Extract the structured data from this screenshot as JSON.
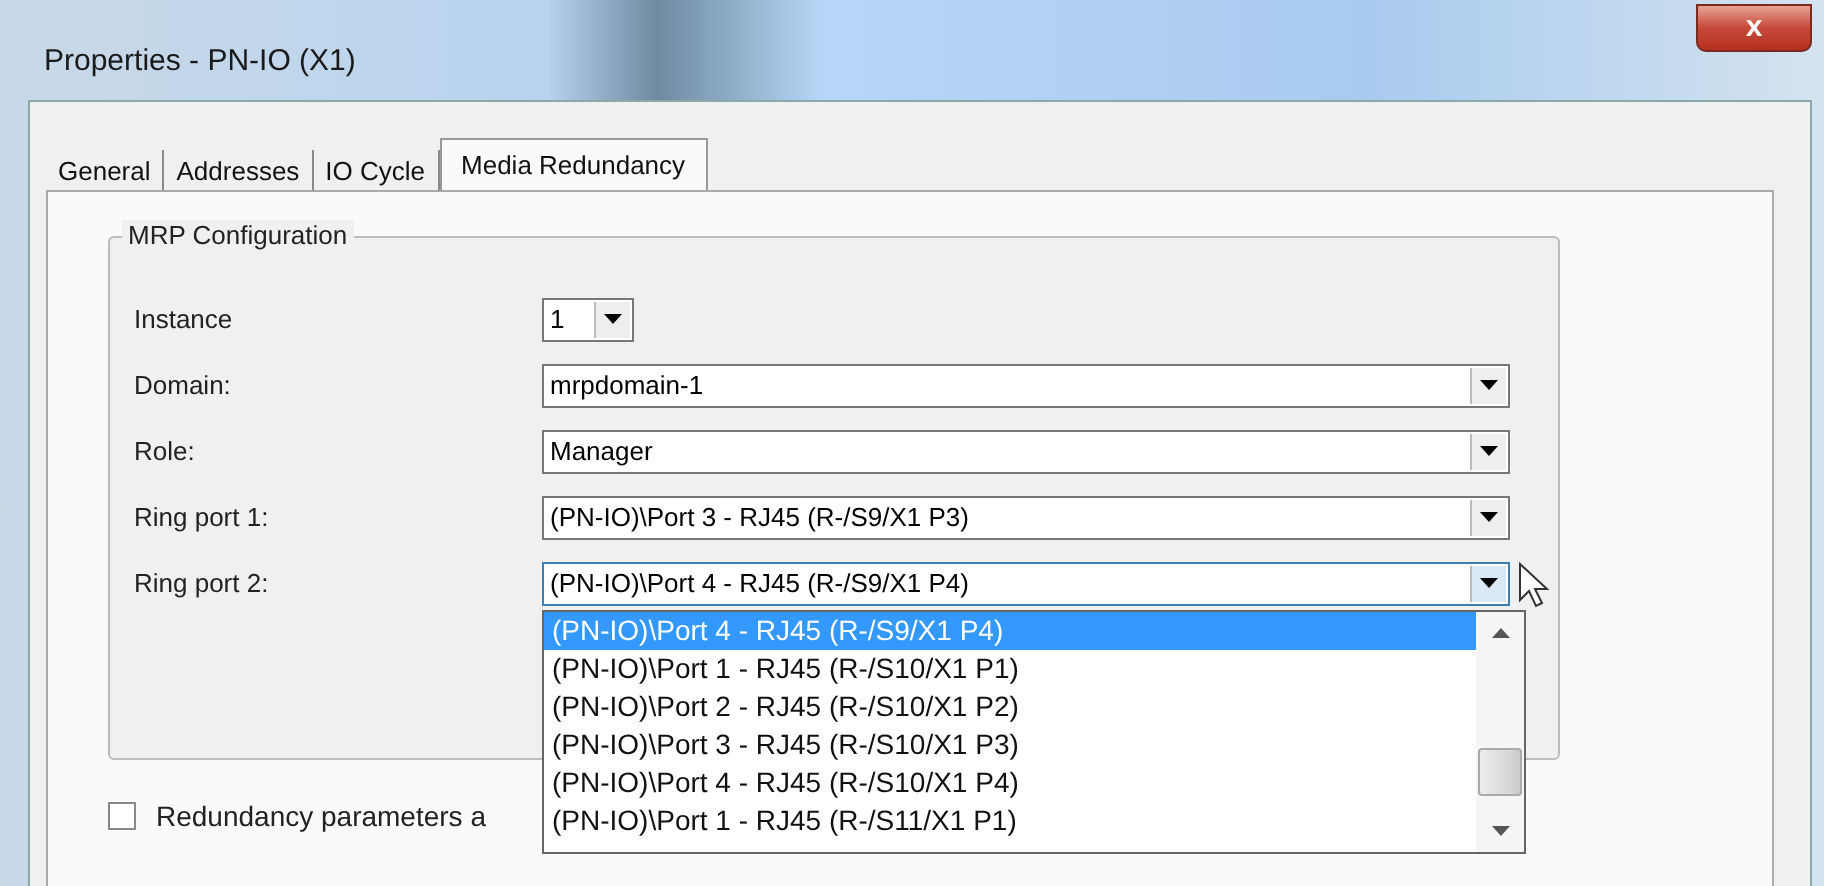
{
  "window": {
    "title": "Properties - PN-IO (X1)",
    "close": "x"
  },
  "tabs": [
    {
      "label": "General",
      "selected": false
    },
    {
      "label": "Addresses",
      "selected": false
    },
    {
      "label": "IO Cycle",
      "selected": false
    },
    {
      "label": "Media Redundancy",
      "selected": true
    }
  ],
  "group": {
    "title": "MRP Configuration",
    "fields": [
      {
        "label": "Instance",
        "value": "1",
        "kind": "small"
      },
      {
        "label": "Domain:",
        "value": "mrpdomain-1",
        "kind": "wide"
      },
      {
        "label": "Role:",
        "value": "Manager",
        "kind": "wide"
      },
      {
        "label": "Ring port 1:",
        "value": "(PN-IO)\\Port 3 - RJ45 (R-/S9/X1 P3)",
        "kind": "wide"
      },
      {
        "label": "Ring port 2:",
        "value": "(PN-IO)\\Port 4 - RJ45 (R-/S9/X1 P4)",
        "kind": "wide",
        "expanded": true
      }
    ]
  },
  "dropdown_options": [
    {
      "label": "(PN-IO)\\Port 4 - RJ45 (R-/S9/X1 P4)",
      "selected": true
    },
    {
      "label": "(PN-IO)\\Port 1 - RJ45 (R-/S10/X1 P1)",
      "selected": false
    },
    {
      "label": "(PN-IO)\\Port 2 - RJ45 (R-/S10/X1 P2)",
      "selected": false
    },
    {
      "label": "(PN-IO)\\Port 3 - RJ45 (R-/S10/X1 P3)",
      "selected": false
    },
    {
      "label": "(PN-IO)\\Port 4 - RJ45 (R-/S10/X1 P4)",
      "selected": false
    },
    {
      "label": "(PN-IO)\\Port 1 - RJ45 (R-/S11/X1 P1)",
      "selected": false
    }
  ],
  "checkbox": {
    "label": "Redundancy parameters a",
    "checked": false
  }
}
